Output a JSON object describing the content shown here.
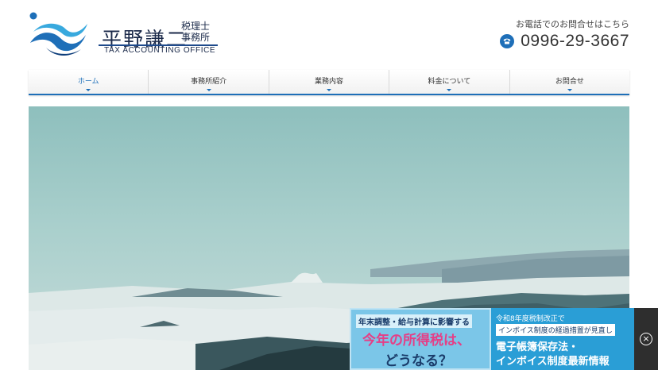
{
  "header": {
    "office_name": "平野謙二",
    "office_type_line1": "税理士",
    "office_type_line2": "事務所",
    "office_en": "TAX ACCOUNTING OFFICE",
    "contact_label": "お電話でのお問合せはこちら",
    "phone_number": "0996-29-3667",
    "icons": {
      "logo": "wave-logo-icon",
      "phone": "phone-icon"
    }
  },
  "nav": {
    "items": [
      {
        "label": "ホーム",
        "active": true
      },
      {
        "label": "事務所紹介",
        "active": false
      },
      {
        "label": "業務内容",
        "active": false
      },
      {
        "label": "料金について",
        "active": false
      },
      {
        "label": "お問合せ",
        "active": false
      }
    ],
    "icon": "chevron-down-icon"
  },
  "hero": {
    "image": "sea-of-clouds-photo"
  },
  "banners": {
    "left": {
      "headline": "年末調整・給与計算に影響する",
      "title": "今年の所得税は、",
      "subtitle": "どうなる？"
    },
    "right": {
      "line1": "令和8年度税制改正で",
      "line2": "インボイス制度の経過措置が見直し",
      "line3": "電子帳簿保存法・",
      "line4": "インボイス制度最新情報"
    },
    "close_symbol": "×"
  },
  "colors": {
    "brand": "#1e6fb8",
    "logo_text": "#1b2a4a",
    "banner_pink": "#e53f86",
    "banner_blue": "#2a9ed6"
  }
}
